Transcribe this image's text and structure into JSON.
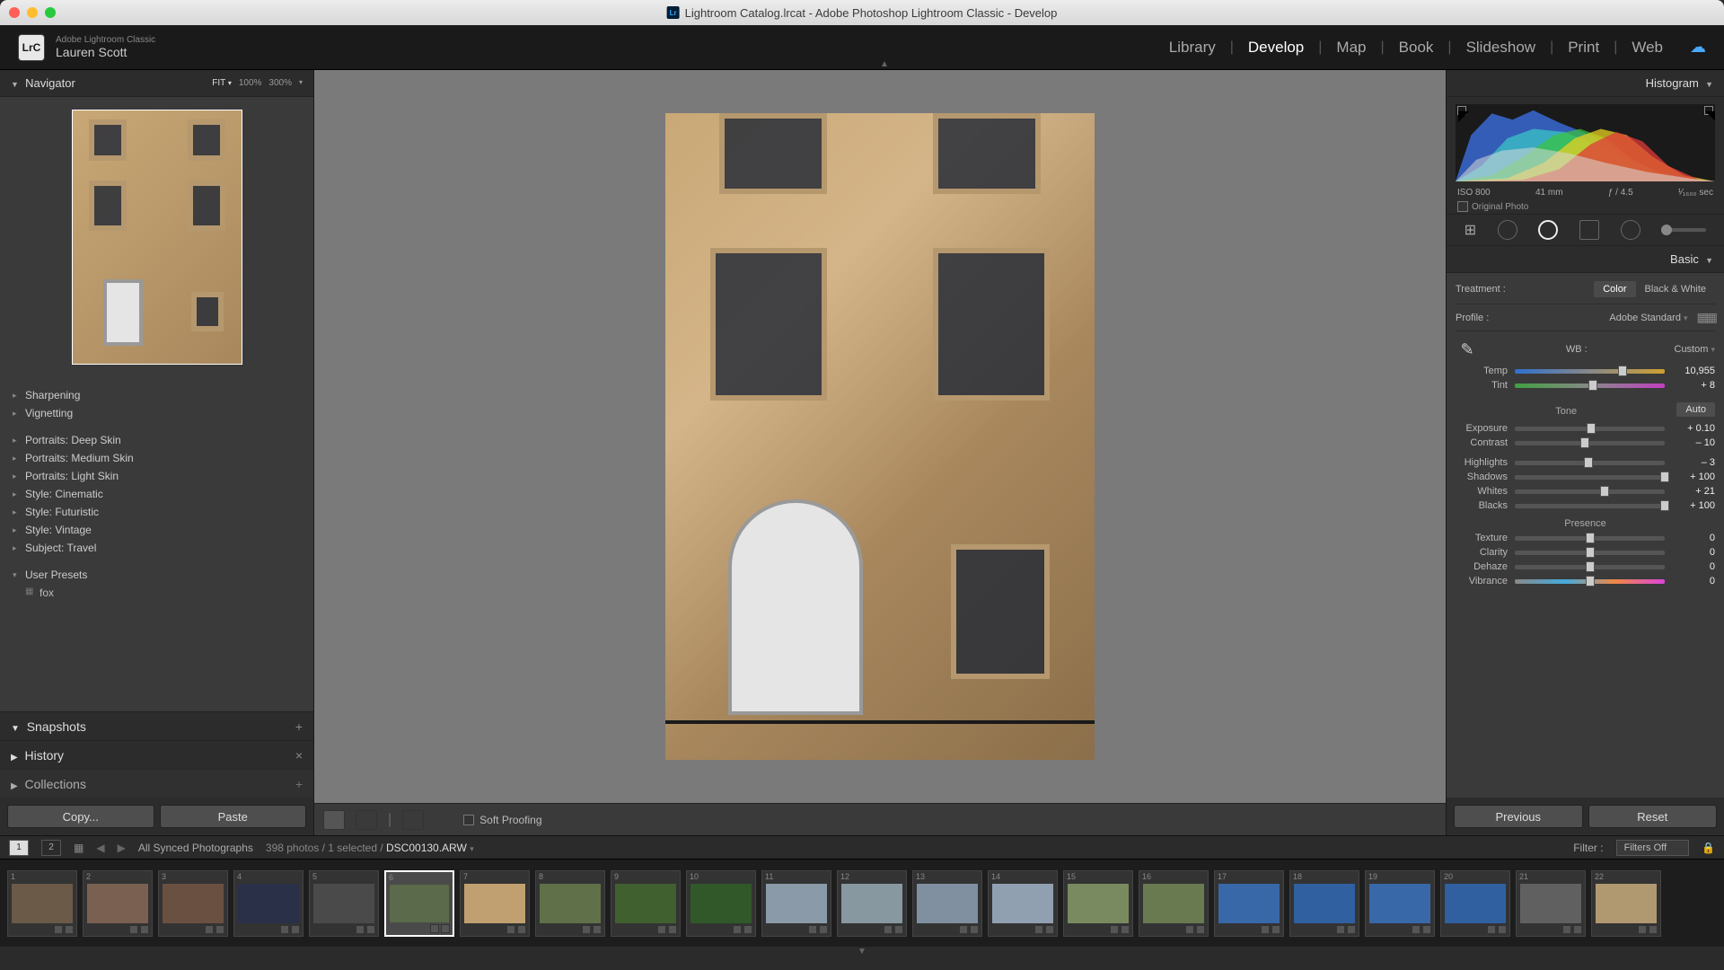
{
  "titlebar": {
    "title": "Lightroom Catalog.lrcat - Adobe Photoshop Lightroom Classic - Develop"
  },
  "header": {
    "app_small": "Adobe Lightroom Classic",
    "user_name": "Lauren Scott",
    "logo_text": "LrC",
    "modules": [
      "Library",
      "Develop",
      "Map",
      "Book",
      "Slideshow",
      "Print",
      "Web"
    ],
    "active_module": "Develop"
  },
  "navigator": {
    "title": "Navigator",
    "zoom_levels": [
      "FIT",
      "100%",
      "300%"
    ]
  },
  "presets": [
    {
      "label": "Sharpening",
      "type": "group"
    },
    {
      "label": "Vignetting",
      "type": "group"
    },
    {
      "label": "",
      "type": "spacer"
    },
    {
      "label": "Portraits: Deep Skin",
      "type": "group"
    },
    {
      "label": "Portraits: Medium Skin",
      "type": "group"
    },
    {
      "label": "Portraits: Light Skin",
      "type": "group"
    },
    {
      "label": "Style: Cinematic",
      "type": "group"
    },
    {
      "label": "Style: Futuristic",
      "type": "group"
    },
    {
      "label": "Style: Vintage",
      "type": "group"
    },
    {
      "label": "Subject: Travel",
      "type": "group"
    },
    {
      "label": "",
      "type": "spacer"
    },
    {
      "label": "User Presets",
      "type": "group-open"
    },
    {
      "label": "fox",
      "type": "child"
    }
  ],
  "left_sections": {
    "snapshots": "Snapshots",
    "history": "History",
    "collections": "Collections"
  },
  "left_buttons": {
    "copy": "Copy...",
    "paste": "Paste"
  },
  "center": {
    "soft_proofing": "Soft Proofing"
  },
  "right": {
    "histogram_title": "Histogram",
    "histo_meta": {
      "iso": "ISO 800",
      "focal": "41 mm",
      "aperture": "ƒ / 4.5",
      "shutter": "¹⁄₁₆₀₀ sec"
    },
    "original_photo": "Original Photo",
    "basic_title": "Basic",
    "treatment_label": "Treatment :",
    "treatment_color": "Color",
    "treatment_bw": "Black & White",
    "profile_label": "Profile :",
    "profile_value": "Adobe Standard",
    "wb_label": "WB :",
    "wb_value": "Custom",
    "tone_label": "Tone",
    "auto_label": "Auto",
    "presence_label": "Presence",
    "sliders": {
      "temp": {
        "label": "Temp",
        "value": "10,955",
        "pos": 72
      },
      "tint": {
        "label": "Tint",
        "value": "+ 8",
        "pos": 52
      },
      "exposure": {
        "label": "Exposure",
        "value": "+ 0.10",
        "pos": 51
      },
      "contrast": {
        "label": "Contrast",
        "value": "– 10",
        "pos": 47
      },
      "highlights": {
        "label": "Highlights",
        "value": "– 3",
        "pos": 49
      },
      "shadows": {
        "label": "Shadows",
        "value": "+ 100",
        "pos": 100
      },
      "whites": {
        "label": "Whites",
        "value": "+ 21",
        "pos": 60
      },
      "blacks": {
        "label": "Blacks",
        "value": "+ 100",
        "pos": 100
      },
      "texture": {
        "label": "Texture",
        "value": "0",
        "pos": 50
      },
      "clarity": {
        "label": "Clarity",
        "value": "0",
        "pos": 50
      },
      "dehaze": {
        "label": "Dehaze",
        "value": "0",
        "pos": 50
      },
      "vibrance": {
        "label": "Vibrance",
        "value": "0",
        "pos": 50
      }
    },
    "previous": "Previous",
    "reset": "Reset"
  },
  "filminfo": {
    "source": "All Synced Photographs",
    "count": "398 photos / 1 selected /",
    "filename": "DSC00130.ARW",
    "filter_label": "Filter :",
    "filter_value": "Filters Off"
  },
  "thumbs": {
    "count": 22,
    "selected_index": 6,
    "colors": [
      "#6b5a48",
      "#7a6050",
      "#6a5040",
      "#2a3048",
      "#4a4a4a",
      "#5a6a4a",
      "#c0a070",
      "#607048",
      "#406030",
      "#305828",
      "#8a9aa8",
      "#8898a0",
      "#8090a0",
      "#90a0b0",
      "#7a8a60",
      "#6a7a50",
      "#3868a8",
      "#3060a0",
      "#3868a8",
      "#3060a0",
      "#606060",
      "#b09870"
    ]
  }
}
